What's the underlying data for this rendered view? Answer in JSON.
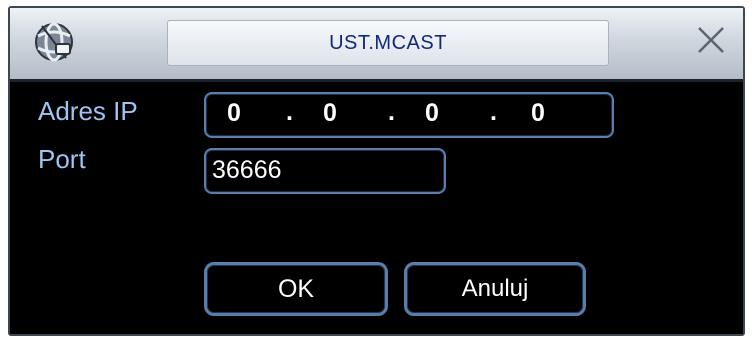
{
  "dialog": {
    "title": "UST.MCAST",
    "icons": {
      "app": "app-globe-icon",
      "close": "close-x-icon"
    }
  },
  "fields": {
    "ip": {
      "label": "Adres IP",
      "octets": [
        "0",
        "0",
        "0",
        "0"
      ],
      "separator": "."
    },
    "port": {
      "label": "Port",
      "value": "36666"
    }
  },
  "buttons": {
    "ok": "OK",
    "cancel": "Anuluj"
  },
  "colors": {
    "label_text": "#9fc3f2",
    "title_text": "#102a7a",
    "field_border": "#5b7fad",
    "background": "#000000"
  }
}
